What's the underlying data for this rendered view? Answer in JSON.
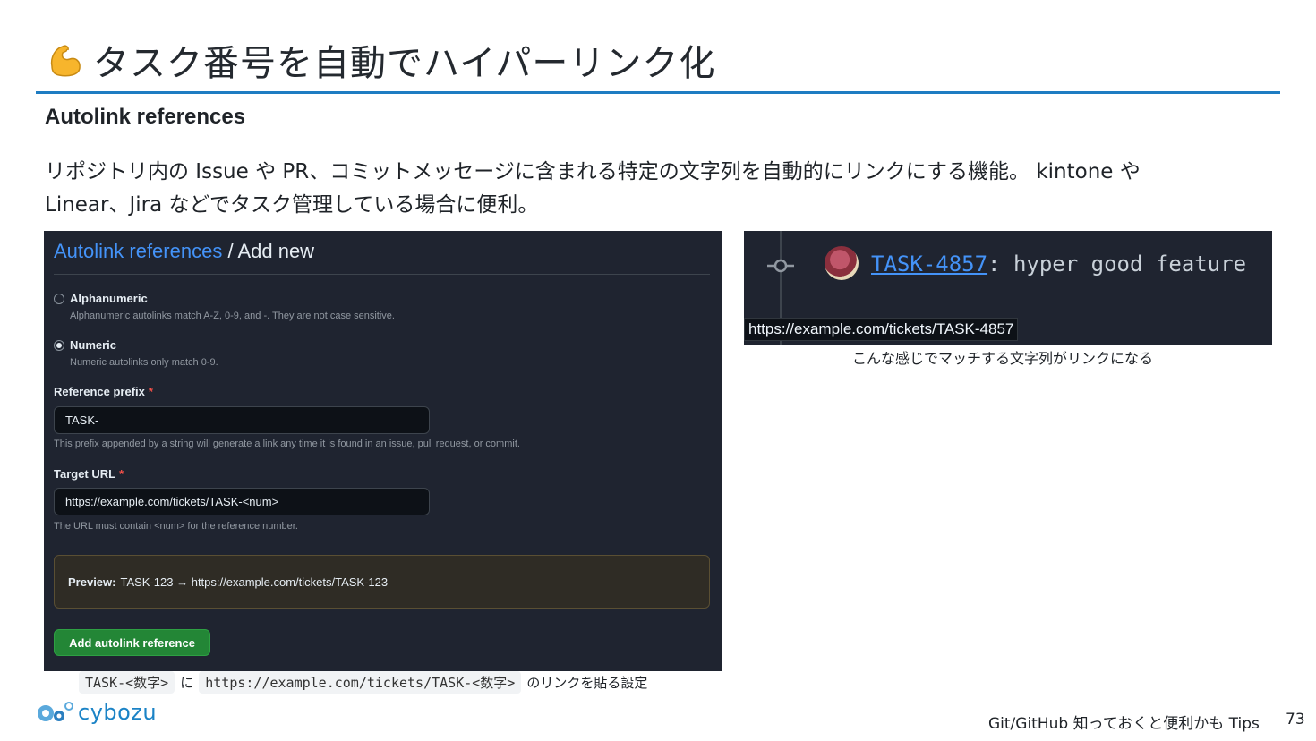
{
  "slide": {
    "title": "タスク番号を自動でハイパーリンク化",
    "title_icon": "flexed-biceps-emoji",
    "subheading": "Autolink references",
    "description": "リポジトリ内の Issue や PR、コミットメッセージに含まれる特定の文字列を自動的にリンクにする機能。 kintone や Linear、Jira などでタスク管理している場合に便利。",
    "accent_color": "#1e7cc2"
  },
  "form": {
    "breadcrumb_link": "Autolink references",
    "breadcrumb_sep": " / ",
    "breadcrumb_current": "Add new",
    "alphanumeric": {
      "label": "Alphanumeric",
      "help": "Alphanumeric autolinks match A-Z, 0-9, and -. They are not case sensitive.",
      "checked": false
    },
    "numeric": {
      "label": "Numeric",
      "help": "Numeric autolinks only match 0-9.",
      "checked": true
    },
    "prefix": {
      "label": "Reference prefix",
      "required_mark": "*",
      "value": "TASK-",
      "help": "This prefix appended by a string will generate a link any time it is found in an issue, pull request, or commit."
    },
    "target_url": {
      "label": "Target URL",
      "required_mark": "*",
      "value": "https://example.com/tickets/TASK-<num>",
      "help": "The URL must contain <num> for the reference number."
    },
    "preview": {
      "label": "Preview:",
      "text": "TASK-123 → https://example.com/tickets/TASK-123"
    },
    "submit_label": "Add autolink reference",
    "button_color": "#238636"
  },
  "caption_left": {
    "code1": "TASK-<数字>",
    "mid": "に",
    "code2": "https://example.com/tickets/TASK-<数字>",
    "tail": "のリンクを貼る設定"
  },
  "demo": {
    "link_text": "TASK-4857",
    "rest_text": ": hyper good feature",
    "tooltip": "https://example.com/tickets/TASK-4857",
    "link_color": "#4493f8"
  },
  "caption_right": "こんな感じでマッチする文字列がリンクになる",
  "footer": {
    "logo_text": "cybozu",
    "title": "Git/GitHub 知っておくと便利かも Tips",
    "page": "73"
  }
}
